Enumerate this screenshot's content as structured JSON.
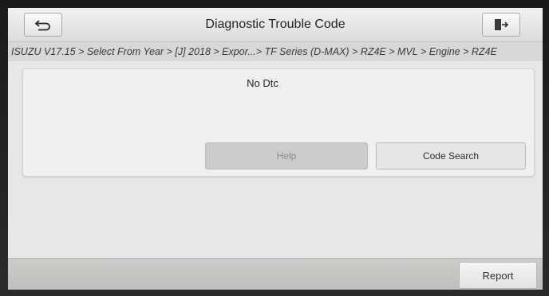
{
  "window": {
    "title": "Diagnostic Trouble Code"
  },
  "icons": {
    "back": "back-arrow-icon",
    "exit": "exit-door-icon"
  },
  "breadcrumb": "ISUZU V17.15 > Select From Year > [J] 2018 > Expor...> TF Series (D-MAX) > RZ4E > MVL > Engine > RZ4E",
  "panel": {
    "message": "No Dtc",
    "help_label": "Help",
    "code_search_label": "Code Search"
  },
  "footer": {
    "report_label": "Report"
  }
}
